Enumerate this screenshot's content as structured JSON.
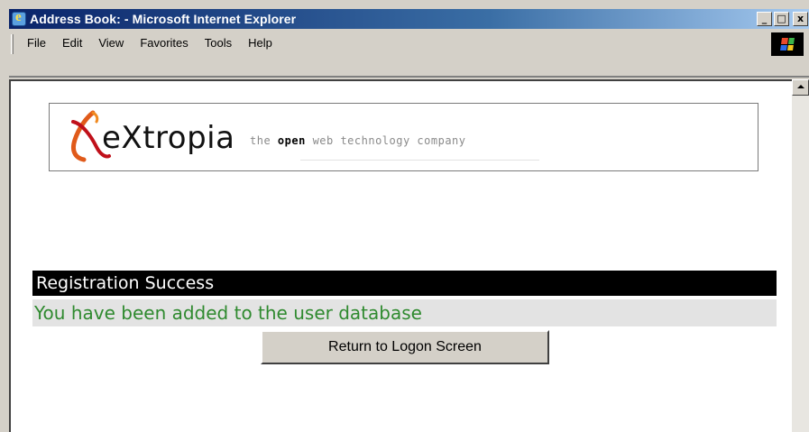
{
  "window": {
    "title": "Address Book: - Microsoft Internet Explorer",
    "minimize_label": "_",
    "maximize_label": "□",
    "close_label": "x"
  },
  "menu": {
    "items": [
      "File",
      "Edit",
      "View",
      "Favorites",
      "Tools",
      "Help"
    ]
  },
  "logo": {
    "wordmark": "eXtropia",
    "tagline_prefix": "the",
    "tagline_bold": "open",
    "tagline_suffix": "web technology company",
    "accent_color": "#e05a1a"
  },
  "content": {
    "header": "Registration Success",
    "message": "You have been added to the user database",
    "return_button": "Return to Logon Screen",
    "message_color": "#2f8a2f"
  },
  "icons": {
    "app": "ie-icon",
    "throbber": "windows-flag-icon",
    "scroll_up": "arrow-up-icon"
  }
}
